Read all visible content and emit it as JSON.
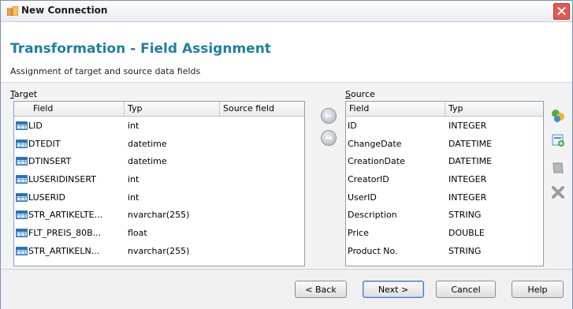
{
  "window": {
    "title": "New Connection"
  },
  "header": {
    "title": "Transformation - Field Assignment",
    "subtitle": "Assignment of target and source data fields"
  },
  "target": {
    "label_accel": "T",
    "label_rest": "arget",
    "columns": [
      "Field",
      "Typ",
      "Source field"
    ],
    "rows": [
      {
        "field": "LID",
        "type": "int",
        "source": ""
      },
      {
        "field": "DTEDIT",
        "type": "datetime",
        "source": ""
      },
      {
        "field": "DTINSERT",
        "type": "datetime",
        "source": ""
      },
      {
        "field": "LUSERIDINSERT",
        "type": "int",
        "source": ""
      },
      {
        "field": "LUSERID",
        "type": "int",
        "source": ""
      },
      {
        "field": "STR_ARTIKELTE...",
        "type": "nvarchar(255)",
        "source": ""
      },
      {
        "field": "FLT_PREIS_80B...",
        "type": "float",
        "source": ""
      },
      {
        "field": "STR_ARTIKELN...",
        "type": "nvarchar(255)",
        "source": ""
      }
    ]
  },
  "source": {
    "label_accel": "S",
    "label_rest": "ource",
    "columns": [
      "Field",
      "Typ"
    ],
    "rows": [
      {
        "field": "ID",
        "type": "INTEGER"
      },
      {
        "field": "ChangeDate",
        "type": "DATETIME"
      },
      {
        "field": "CreationDate",
        "type": "DATETIME"
      },
      {
        "field": "CreatorID",
        "type": "INTEGER"
      },
      {
        "field": "UserID",
        "type": "INTEGER"
      },
      {
        "field": "Description",
        "type": "STRING"
      },
      {
        "field": "Price",
        "type": "DOUBLE"
      },
      {
        "field": "Product No.",
        "type": "STRING"
      }
    ]
  },
  "buttons": {
    "back": "< Back",
    "next": "Next >",
    "cancel": "Cancel",
    "help": "Help"
  },
  "colors": {
    "accent_title": "#1f7fa0",
    "close": "#e6584f"
  }
}
